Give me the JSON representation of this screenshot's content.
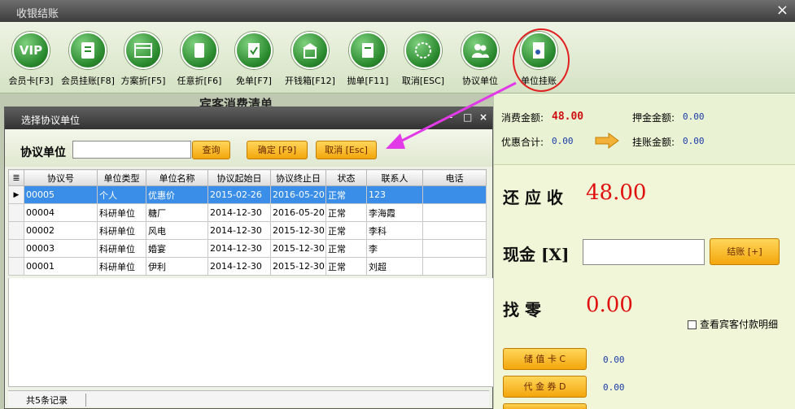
{
  "window": {
    "title": "收银结账",
    "close": "×"
  },
  "toolbar": [
    {
      "label": "会员卡[F3]",
      "icon": "vip-card-icon",
      "glyph": "VIP"
    },
    {
      "label": "会员挂账[F8]",
      "icon": "member-credit-icon",
      "glyph": ""
    },
    {
      "label": "方案折[F5]",
      "icon": "plan-discount-icon",
      "glyph": ""
    },
    {
      "label": "任意折[F6]",
      "icon": "custom-discount-icon",
      "glyph": ""
    },
    {
      "label": "免单[F7]",
      "icon": "free-order-icon",
      "glyph": ""
    },
    {
      "label": "开钱箱[F12]",
      "icon": "cash-drawer-icon",
      "glyph": ""
    },
    {
      "label": "抛单[F11]",
      "icon": "suspend-order-icon",
      "glyph": ""
    },
    {
      "label": "取消[ESC]",
      "icon": "cancel-icon",
      "glyph": ""
    },
    {
      "label": "协议单位",
      "icon": "agreement-unit-icon",
      "glyph": ""
    },
    {
      "label": "单位挂账",
      "icon": "unit-credit-icon",
      "glyph": ""
    }
  ],
  "background": {
    "title": "宾客消费清单"
  },
  "summary": {
    "consume_label": "消费金额:",
    "consume_value": "48.00",
    "deposit_label": "押金金额:",
    "deposit_value": "0.00",
    "discount_label": "优惠合计:",
    "discount_value": "0.00",
    "credit_label": "挂账金额:",
    "credit_value": "0.00"
  },
  "payment": {
    "due_label": "还 应 收",
    "due_value": "48.00",
    "cash_label": "现金 [X]",
    "cash_value": "",
    "checkout_button": "结账 [+]",
    "change_label": "找   零",
    "change_value": "0.00",
    "detail_checkbox": "查看宾客付款明细",
    "stored_card_button": "储 值 卡 C",
    "stored_card_value": "0.00",
    "voucher_button": "代 金 券 D",
    "voucher_value": "0.00"
  },
  "dialog": {
    "title": "选择协议单位",
    "controls": [
      "-",
      "□",
      "×"
    ],
    "search_label": "协议单位",
    "search_value": "",
    "query_button": "查询",
    "confirm_button": "确定 [F9]",
    "cancel_button": "取消 [Esc]",
    "columns": [
      "协议号",
      "单位类型",
      "单位名称",
      "协议起始日",
      "协议终止日",
      "状态",
      "联系人",
      "电话"
    ],
    "rows": [
      [
        "00005",
        "个人",
        "优惠价",
        "2015-02-26",
        "2016-05-20",
        "正常",
        "123",
        ""
      ],
      [
        "00004",
        "科研单位",
        "糖厂",
        "2014-12-30",
        "2016-05-20",
        "正常",
        "李海霞",
        ""
      ],
      [
        "00002",
        "科研单位",
        "风电",
        "2014-12-30",
        "2015-12-30",
        "正常",
        "李科",
        ""
      ],
      [
        "00003",
        "科研单位",
        "婚宴",
        "2014-12-30",
        "2015-12-30",
        "正常",
        "李",
        ""
      ],
      [
        "00001",
        "科研单位",
        "伊利",
        "2014-12-30",
        "2015-12-30",
        "正常",
        "刘超",
        ""
      ]
    ],
    "selected_row": 0,
    "record_count": "共5条记录"
  }
}
